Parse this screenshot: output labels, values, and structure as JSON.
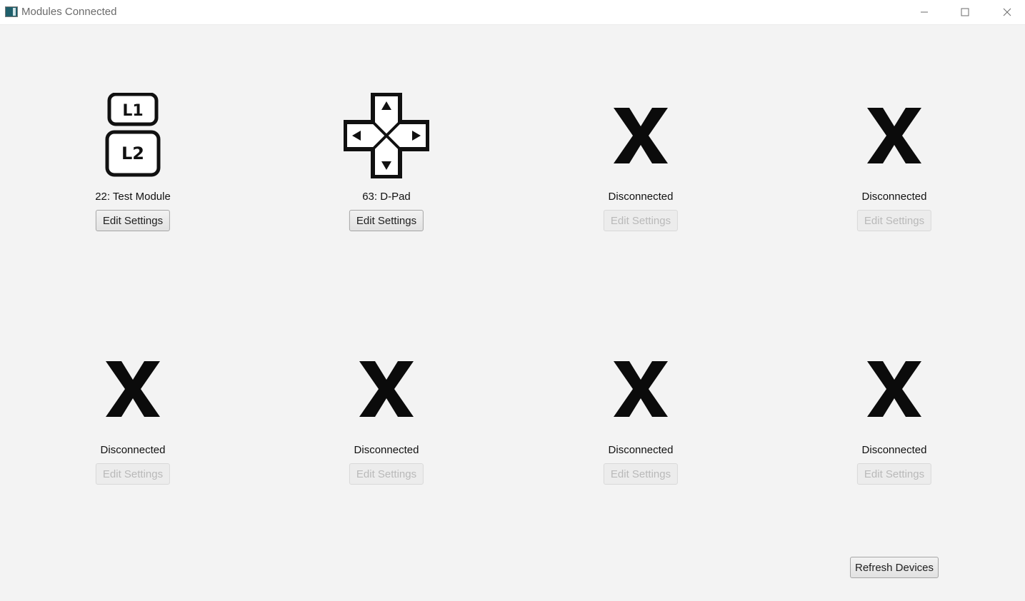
{
  "window": {
    "title": "Modules Connected",
    "controls": [
      "minimize-icon",
      "maximize-icon",
      "close-icon"
    ]
  },
  "modules": [
    {
      "label": "22: Test Module",
      "icon": "l1-l2-buttons-icon",
      "button": "Edit Settings",
      "enabled": true
    },
    {
      "label": "63: D-Pad",
      "icon": "dpad-icon",
      "button": "Edit Settings",
      "enabled": true
    },
    {
      "label": "Disconnected",
      "icon": "x-disconnected-icon",
      "button": "Edit Settings",
      "enabled": false
    },
    {
      "label": "Disconnected",
      "icon": "x-disconnected-icon",
      "button": "Edit Settings",
      "enabled": false
    },
    {
      "label": "Disconnected",
      "icon": "x-disconnected-icon",
      "button": "Edit Settings",
      "enabled": false
    },
    {
      "label": "Disconnected",
      "icon": "x-disconnected-icon",
      "button": "Edit Settings",
      "enabled": false
    },
    {
      "label": "Disconnected",
      "icon": "x-disconnected-icon",
      "button": "Edit Settings",
      "enabled": false
    },
    {
      "label": "Disconnected",
      "icon": "x-disconnected-icon",
      "button": "Edit Settings",
      "enabled": false
    }
  ],
  "footer": {
    "refresh_label": "Refresh Devices"
  }
}
